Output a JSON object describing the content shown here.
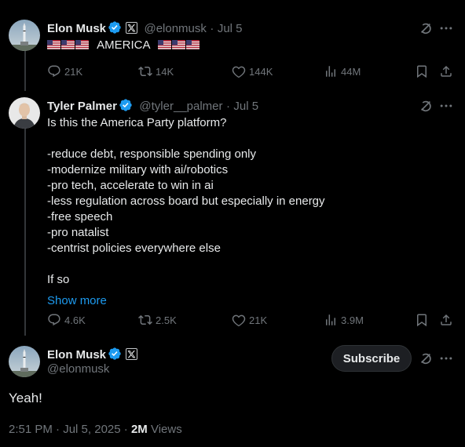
{
  "tweet1": {
    "author_name": "Elon Musk",
    "handle": "@elonmusk",
    "dot": "·",
    "date": "Jul 5",
    "text": "AMERICA",
    "metrics": {
      "replies": "21K",
      "retweets": "14K",
      "likes": "144K",
      "views": "44M"
    }
  },
  "tweet2": {
    "author_name": "Tyler Palmer",
    "handle": "@tyler__palmer",
    "dot": "·",
    "date": "Jul 5",
    "lines": [
      "Is this the America Party platform?",
      "",
      "-reduce debt, responsible spending only",
      "-modernize military with ai/robotics",
      "-pro tech, accelerate to win in ai",
      "-less regulation across board but especially in energy",
      "-free speech",
      "-pro natalist",
      "-centrist policies everywhere else",
      "",
      "If so"
    ],
    "show_more": "Show more",
    "metrics": {
      "replies": "4.6K",
      "retweets": "2.5K",
      "likes": "21K",
      "views": "3.9M"
    }
  },
  "tweet3": {
    "author_name": "Elon Musk",
    "handle": "@elonmusk",
    "subscribe_label": "Subscribe",
    "text": "Yeah!",
    "time": "2:51 PM",
    "dot": "·",
    "date": "Jul 5, 2025",
    "dot2": "·",
    "views_count": "2M",
    "views_label": "Views"
  },
  "colors": {
    "accent": "#1d9bf0",
    "muted": "#71767b",
    "text": "#e7e9ea",
    "background": "#000000"
  },
  "icons": [
    "verified-badge-icon",
    "x-affiliate-icon",
    "grok-icon",
    "more-icon",
    "reply-icon",
    "retweet-icon",
    "like-icon",
    "views-icon",
    "bookmark-icon",
    "share-icon",
    "flag-usa-icon"
  ]
}
